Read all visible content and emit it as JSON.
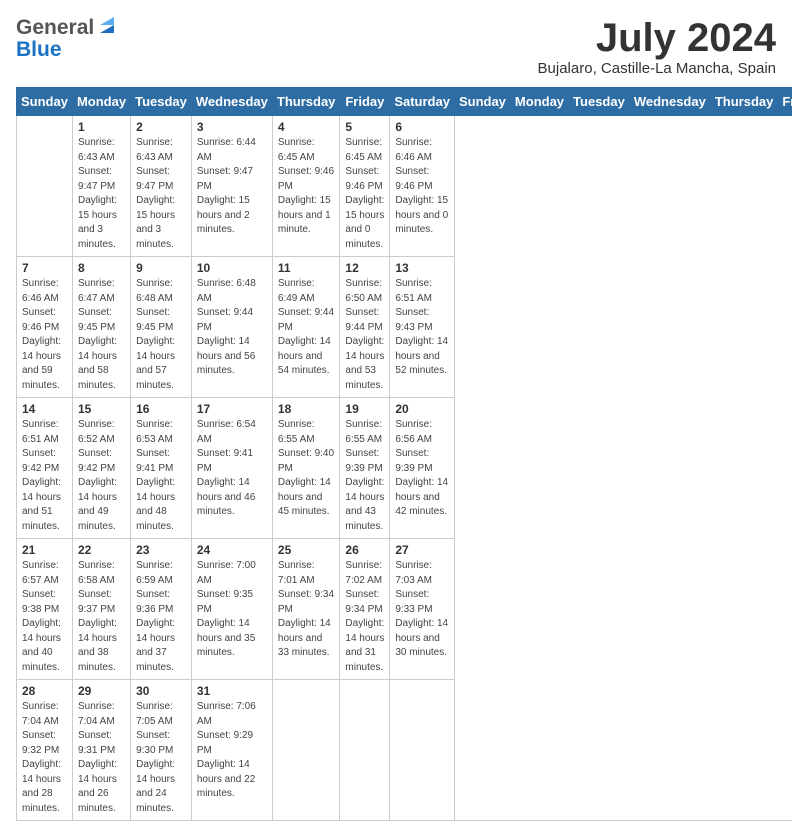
{
  "header": {
    "logo_general": "General",
    "logo_blue": "Blue",
    "month_title": "July 2024",
    "location": "Bujalaro, Castille-La Mancha, Spain"
  },
  "days_of_week": [
    "Sunday",
    "Monday",
    "Tuesday",
    "Wednesday",
    "Thursday",
    "Friday",
    "Saturday"
  ],
  "weeks": [
    [
      {
        "day": "",
        "sunrise": "",
        "sunset": "",
        "daylight": ""
      },
      {
        "day": "1",
        "sunrise": "Sunrise: 6:43 AM",
        "sunset": "Sunset: 9:47 PM",
        "daylight": "Daylight: 15 hours and 3 minutes."
      },
      {
        "day": "2",
        "sunrise": "Sunrise: 6:43 AM",
        "sunset": "Sunset: 9:47 PM",
        "daylight": "Daylight: 15 hours and 3 minutes."
      },
      {
        "day": "3",
        "sunrise": "Sunrise: 6:44 AM",
        "sunset": "Sunset: 9:47 PM",
        "daylight": "Daylight: 15 hours and 2 minutes."
      },
      {
        "day": "4",
        "sunrise": "Sunrise: 6:45 AM",
        "sunset": "Sunset: 9:46 PM",
        "daylight": "Daylight: 15 hours and 1 minute."
      },
      {
        "day": "5",
        "sunrise": "Sunrise: 6:45 AM",
        "sunset": "Sunset: 9:46 PM",
        "daylight": "Daylight: 15 hours and 0 minutes."
      },
      {
        "day": "6",
        "sunrise": "Sunrise: 6:46 AM",
        "sunset": "Sunset: 9:46 PM",
        "daylight": "Daylight: 15 hours and 0 minutes."
      }
    ],
    [
      {
        "day": "7",
        "sunrise": "Sunrise: 6:46 AM",
        "sunset": "Sunset: 9:46 PM",
        "daylight": "Daylight: 14 hours and 59 minutes."
      },
      {
        "day": "8",
        "sunrise": "Sunrise: 6:47 AM",
        "sunset": "Sunset: 9:45 PM",
        "daylight": "Daylight: 14 hours and 58 minutes."
      },
      {
        "day": "9",
        "sunrise": "Sunrise: 6:48 AM",
        "sunset": "Sunset: 9:45 PM",
        "daylight": "Daylight: 14 hours and 57 minutes."
      },
      {
        "day": "10",
        "sunrise": "Sunrise: 6:48 AM",
        "sunset": "Sunset: 9:44 PM",
        "daylight": "Daylight: 14 hours and 56 minutes."
      },
      {
        "day": "11",
        "sunrise": "Sunrise: 6:49 AM",
        "sunset": "Sunset: 9:44 PM",
        "daylight": "Daylight: 14 hours and 54 minutes."
      },
      {
        "day": "12",
        "sunrise": "Sunrise: 6:50 AM",
        "sunset": "Sunset: 9:44 PM",
        "daylight": "Daylight: 14 hours and 53 minutes."
      },
      {
        "day": "13",
        "sunrise": "Sunrise: 6:51 AM",
        "sunset": "Sunset: 9:43 PM",
        "daylight": "Daylight: 14 hours and 52 minutes."
      }
    ],
    [
      {
        "day": "14",
        "sunrise": "Sunrise: 6:51 AM",
        "sunset": "Sunset: 9:42 PM",
        "daylight": "Daylight: 14 hours and 51 minutes."
      },
      {
        "day": "15",
        "sunrise": "Sunrise: 6:52 AM",
        "sunset": "Sunset: 9:42 PM",
        "daylight": "Daylight: 14 hours and 49 minutes."
      },
      {
        "day": "16",
        "sunrise": "Sunrise: 6:53 AM",
        "sunset": "Sunset: 9:41 PM",
        "daylight": "Daylight: 14 hours and 48 minutes."
      },
      {
        "day": "17",
        "sunrise": "Sunrise: 6:54 AM",
        "sunset": "Sunset: 9:41 PM",
        "daylight": "Daylight: 14 hours and 46 minutes."
      },
      {
        "day": "18",
        "sunrise": "Sunrise: 6:55 AM",
        "sunset": "Sunset: 9:40 PM",
        "daylight": "Daylight: 14 hours and 45 minutes."
      },
      {
        "day": "19",
        "sunrise": "Sunrise: 6:55 AM",
        "sunset": "Sunset: 9:39 PM",
        "daylight": "Daylight: 14 hours and 43 minutes."
      },
      {
        "day": "20",
        "sunrise": "Sunrise: 6:56 AM",
        "sunset": "Sunset: 9:39 PM",
        "daylight": "Daylight: 14 hours and 42 minutes."
      }
    ],
    [
      {
        "day": "21",
        "sunrise": "Sunrise: 6:57 AM",
        "sunset": "Sunset: 9:38 PM",
        "daylight": "Daylight: 14 hours and 40 minutes."
      },
      {
        "day": "22",
        "sunrise": "Sunrise: 6:58 AM",
        "sunset": "Sunset: 9:37 PM",
        "daylight": "Daylight: 14 hours and 38 minutes."
      },
      {
        "day": "23",
        "sunrise": "Sunrise: 6:59 AM",
        "sunset": "Sunset: 9:36 PM",
        "daylight": "Daylight: 14 hours and 37 minutes."
      },
      {
        "day": "24",
        "sunrise": "Sunrise: 7:00 AM",
        "sunset": "Sunset: 9:35 PM",
        "daylight": "Daylight: 14 hours and 35 minutes."
      },
      {
        "day": "25",
        "sunrise": "Sunrise: 7:01 AM",
        "sunset": "Sunset: 9:34 PM",
        "daylight": "Daylight: 14 hours and 33 minutes."
      },
      {
        "day": "26",
        "sunrise": "Sunrise: 7:02 AM",
        "sunset": "Sunset: 9:34 PM",
        "daylight": "Daylight: 14 hours and 31 minutes."
      },
      {
        "day": "27",
        "sunrise": "Sunrise: 7:03 AM",
        "sunset": "Sunset: 9:33 PM",
        "daylight": "Daylight: 14 hours and 30 minutes."
      }
    ],
    [
      {
        "day": "28",
        "sunrise": "Sunrise: 7:04 AM",
        "sunset": "Sunset: 9:32 PM",
        "daylight": "Daylight: 14 hours and 28 minutes."
      },
      {
        "day": "29",
        "sunrise": "Sunrise: 7:04 AM",
        "sunset": "Sunset: 9:31 PM",
        "daylight": "Daylight: 14 hours and 26 minutes."
      },
      {
        "day": "30",
        "sunrise": "Sunrise: 7:05 AM",
        "sunset": "Sunset: 9:30 PM",
        "daylight": "Daylight: 14 hours and 24 minutes."
      },
      {
        "day": "31",
        "sunrise": "Sunrise: 7:06 AM",
        "sunset": "Sunset: 9:29 PM",
        "daylight": "Daylight: 14 hours and 22 minutes."
      },
      {
        "day": "",
        "sunrise": "",
        "sunset": "",
        "daylight": ""
      },
      {
        "day": "",
        "sunrise": "",
        "sunset": "",
        "daylight": ""
      },
      {
        "day": "",
        "sunrise": "",
        "sunset": "",
        "daylight": ""
      }
    ]
  ]
}
